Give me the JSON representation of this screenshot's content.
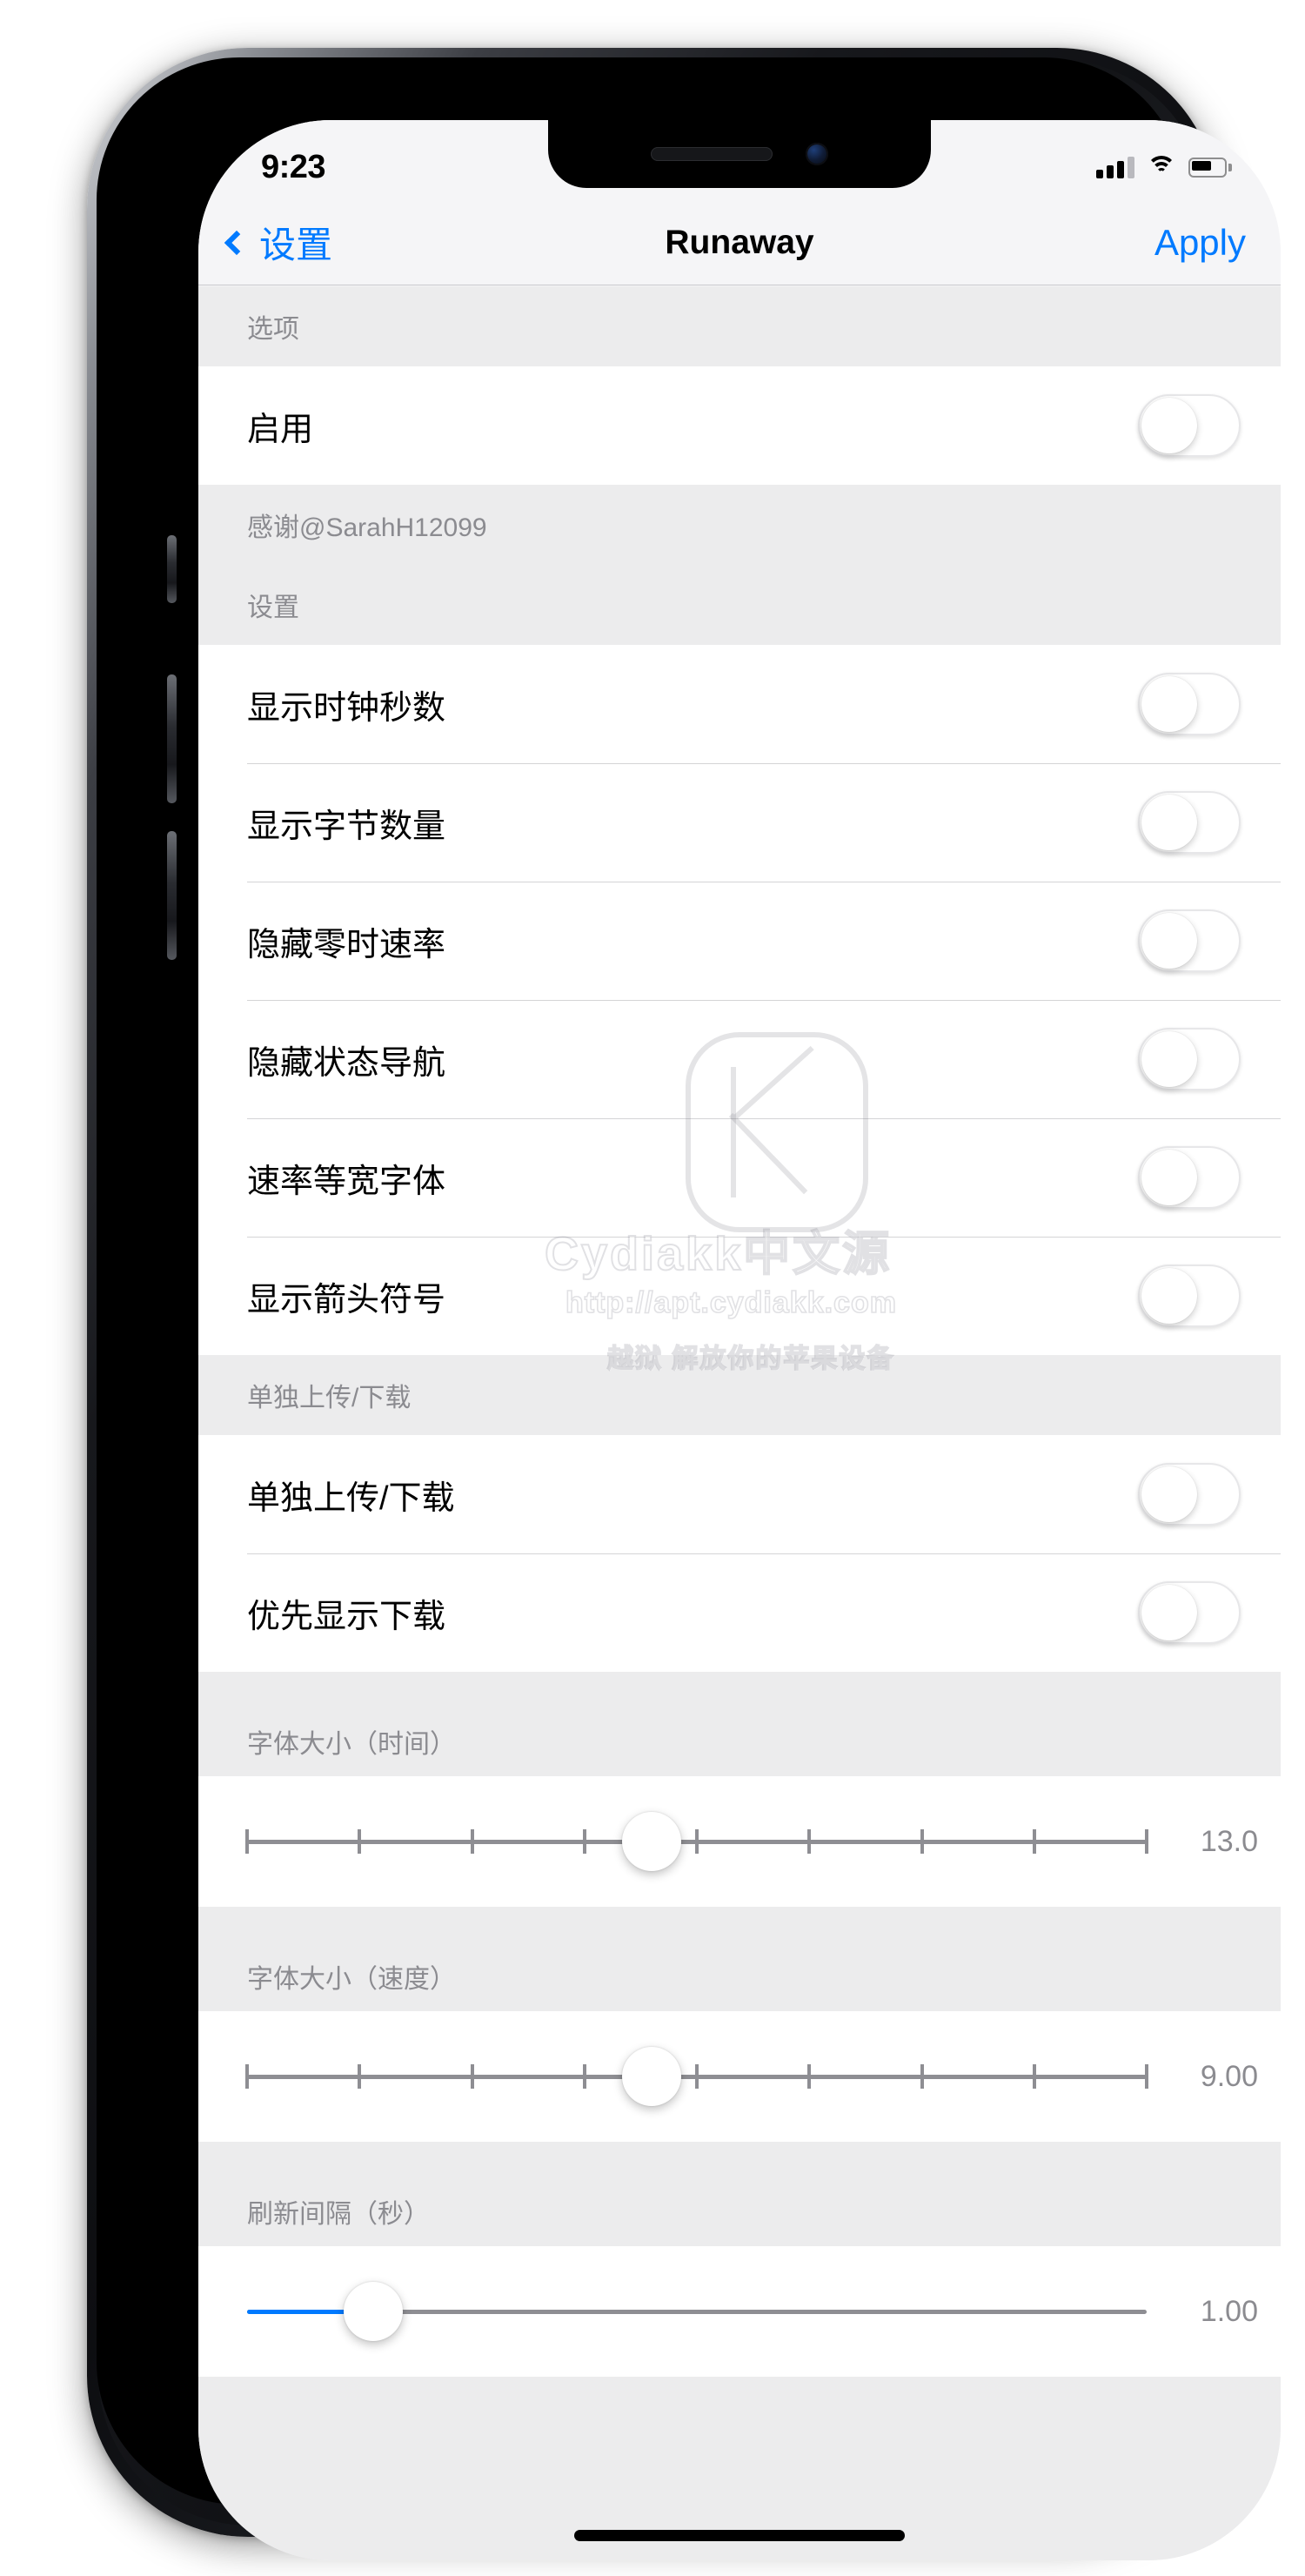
{
  "statusbar": {
    "time": "9:23",
    "signal_icon": "cellular-signal-icon",
    "wifi_icon": "wifi-icon",
    "battery_icon": "battery-icon"
  },
  "navbar": {
    "back_label": "设置",
    "back_icon": "chevron-left-icon",
    "title": "Runaway",
    "apply_label": "Apply",
    "accent_color": "#007aff"
  },
  "sections": [
    {
      "header": "选项",
      "rows": [
        {
          "label": "启用",
          "control": "switch",
          "value": "off"
        }
      ]
    },
    {
      "header": "感谢@SarahH12099",
      "rows": []
    },
    {
      "header": "设置",
      "rows": [
        {
          "label": "显示时钟秒数",
          "control": "switch",
          "value": "off"
        },
        {
          "label": "显示字节数量",
          "control": "switch",
          "value": "off"
        },
        {
          "label": "隐藏零时速率",
          "control": "switch",
          "value": "off"
        },
        {
          "label": "隐藏状态导航",
          "control": "switch",
          "value": "off"
        },
        {
          "label": "速率等宽字体",
          "control": "switch",
          "value": "off"
        },
        {
          "label": "显示箭头符号",
          "control": "switch",
          "value": "off"
        }
      ]
    },
    {
      "header": "单独上传/下载",
      "rows": [
        {
          "label": "单独上传/下载",
          "control": "switch",
          "value": "off"
        },
        {
          "label": "优先显示下载",
          "control": "switch",
          "value": "off"
        }
      ]
    },
    {
      "header": "字体大小（时间）",
      "rows": [
        {
          "control": "slider",
          "value": "13.0",
          "percent": 45,
          "ticks": 9,
          "filled": false
        }
      ]
    },
    {
      "header": "字体大小（速度）",
      "rows": [
        {
          "control": "slider",
          "value": "9.00",
          "percent": 45,
          "ticks": 9,
          "filled": false
        }
      ]
    },
    {
      "header": "刷新间隔（秒）",
      "rows": [
        {
          "control": "slider",
          "value": "1.00",
          "percent": 14,
          "ticks": 0,
          "filled": true
        }
      ]
    }
  ],
  "watermark": {
    "brand": "Cydiakk中文源",
    "url": "http://apt.cydiakk.com",
    "tagline": "越狱 解放你的苹果设备"
  }
}
